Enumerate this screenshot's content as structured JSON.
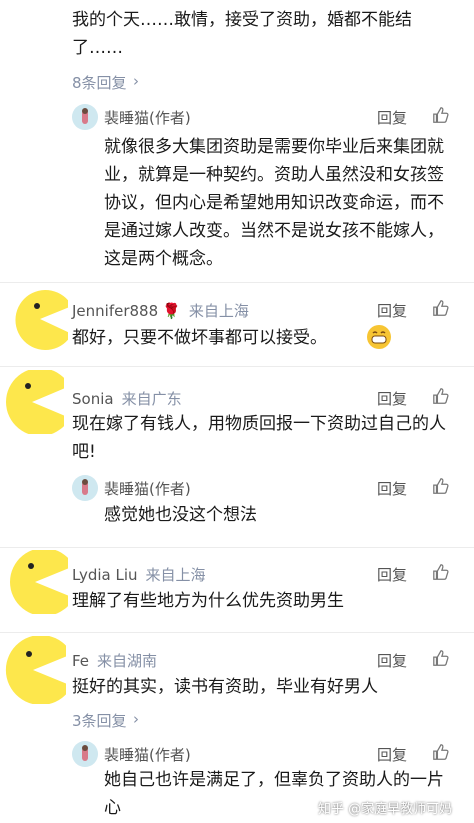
{
  "top_comment": {
    "text": "我的个天……敢情，接受了资助，婚都不能结了……",
    "more_replies": "8条回复"
  },
  "reply1": {
    "name": "裴睡猫(作者)",
    "reply_label": "回复",
    "text": "就像很多大集团资助是需要你毕业后来集团就业，就算是一种契约。资助人虽然没和女孩签协议，但内心是希望她用知识改变命运，而不是通过嫁人改变。当然不是说女孩不能嫁人，这是两个概念。"
  },
  "comment_jennifer": {
    "name": "Jennifer888",
    "location": "来自上海",
    "reply_label": "回复",
    "text": "都好，只要不做坏事都可以接受。"
  },
  "comment_sonia": {
    "name": "Sonia",
    "location": "来自广东",
    "reply_label": "回复",
    "text": "现在嫁了有钱人，用物质回报一下资助过自己的人吧!"
  },
  "reply2": {
    "name": "裴睡猫(作者)",
    "reply_label": "回复",
    "text": "感觉她也没这个想法"
  },
  "comment_lydia": {
    "name": "Lydia Liu",
    "location": "来自上海",
    "reply_label": "回复",
    "text": "理解了有些地方为什么优先资助男生"
  },
  "comment_fe": {
    "name": "Fe",
    "location": "来自湖南",
    "reply_label": "回复",
    "text": "挺好的其实，读书有资助，毕业有好男人",
    "more_replies": "3条回复"
  },
  "reply3": {
    "name": "裴睡猫(作者)",
    "reply_label": "回复",
    "text": "她自己也许是满足了，但辜负了资助人的一片心"
  },
  "watermark": "知乎 @家庭早教师可妈",
  "colors": {
    "pac_yellow": "#fde74c",
    "meta": "#8590a6",
    "text": "#1a1a1a"
  }
}
